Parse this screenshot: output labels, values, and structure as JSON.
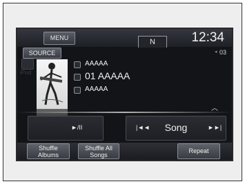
{
  "header": {
    "menu_label": "MENU",
    "gear_label": "N",
    "clock": "12:34"
  },
  "source": {
    "label": "SOURCE",
    "track_number": "03",
    "device_label": "iPod"
  },
  "track": {
    "artist": "AAAAA",
    "title": "01 AAAAA",
    "album": "AAAAA"
  },
  "controls": {
    "play_pause": "►/II",
    "prev": "|◄◄",
    "seek_label": "Song",
    "next": "►►|"
  },
  "buttons": {
    "shuffle_albums": [
      "Shuffle",
      "Albums"
    ],
    "shuffle_all": [
      "Shuffle All",
      "Songs"
    ],
    "repeat": "Repeat"
  }
}
